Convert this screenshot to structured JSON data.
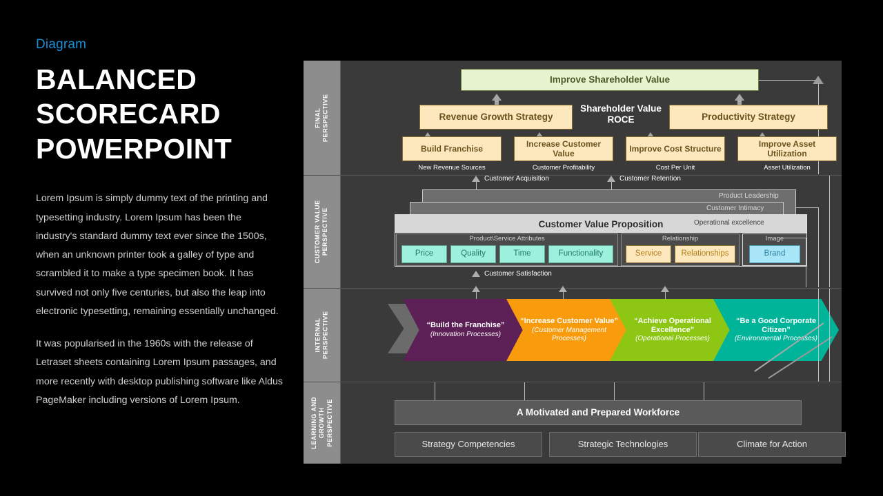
{
  "left": {
    "kicker": "Diagram",
    "title_lines": [
      "BALANCED",
      "SCORECARD",
      "POWERPOINT"
    ],
    "paragraphs": [
      "Lorem Ipsum is simply dummy text of the printing and typesetting industry. Lorem Ipsum has been the industry's standard dummy text ever since the 1500s, when an unknown printer took a galley of type and scrambled it to make a type specimen book. It has survived not only five centuries, but also the leap into electronic typesetting, remaining essentially unchanged.",
      "It was popularised in the 1960s with the release of Letraset sheets containing Lorem Ipsum passages, and more recently with desktop publishing software like Aldus PageMaker including versions of Lorem Ipsum."
    ]
  },
  "colors": {
    "accent_blue": "#1a8fd6",
    "panel_bg": "#3a3a3a",
    "side_label_bg": "#8d8d8d",
    "green_box": "#e8f3cf",
    "cream_box": "#fde8bd",
    "teal_box": "#9df0dc",
    "blue_box": "#a9e7f8",
    "chevron_purple": "#5c1f56",
    "chevron_orange": "#f89c0e",
    "chevron_green": "#8dc713",
    "chevron_teal": "#00b49a",
    "chevron_grey": "#6b6b6b"
  },
  "diagram": {
    "rows": [
      {
        "label": "FINAL\nPERSPECTIVE",
        "label_lines": [
          "FINAL",
          "PERSPECTIVE"
        ]
      },
      {
        "label": "CUSTOMER VALUE\nPERSPECTIVE",
        "label_lines": [
          "CUSTOMER VALUE",
          "PERSPECTIVE"
        ]
      },
      {
        "label": "INTERNAL\nPERSPECTIVE",
        "label_lines": [
          "INTERNAL",
          "PERSPECTIVE"
        ]
      },
      {
        "label": "LEARNING AND\nGROWTH\nPERSPECTIVE",
        "label_lines": [
          "LEARNING AND",
          "GROWTH",
          "PERSPECTIVE"
        ]
      }
    ],
    "final": {
      "top_box": "Improve Shareholder Value",
      "center_metric_line1": "Shareholder Value",
      "center_metric_line2": "ROCE",
      "strategy_left": "Revenue Growth Strategy",
      "strategy_right": "Productivity Strategy",
      "objectives": [
        {
          "title": "Build Franchise",
          "caption": "New Revenue Sources"
        },
        {
          "title": "Increase Customer Value",
          "caption": "Customer Profitability"
        },
        {
          "title": "Improve Cost Structure",
          "caption": "Cost Per Unit"
        },
        {
          "title": "Improve Asset Utilization",
          "caption": "Asset Utilization"
        }
      ]
    },
    "customer": {
      "arrow_labels": [
        "Customer Acquisition",
        "Customer Retention"
      ],
      "layers": [
        "Product Leadership",
        "Customer Intimacy"
      ],
      "proposition_title": "Customer Value Proposition",
      "proposition_tag": "Operational excellence",
      "groups": [
        {
          "name": "Product\\Service Attributes",
          "items": [
            "Price",
            "Quality",
            "Time",
            "Functionality"
          ]
        },
        {
          "name": "Relationship",
          "items": [
            "Service",
            "Relationships"
          ]
        },
        {
          "name": "Image",
          "items": [
            "Brand"
          ]
        }
      ],
      "bottom_label": "Customer Satisfaction"
    },
    "internal": {
      "chevrons": [
        {
          "title": "“Build the Franchise”",
          "subtitle": "(Innovation Processes)",
          "color": "#5c1f56"
        },
        {
          "title": "“Increase Customer Value”",
          "subtitle": "(Customer Management Processes)",
          "color": "#f89c0e"
        },
        {
          "title": "“Achieve Operational Excellence”",
          "subtitle": "(Operational Processes)",
          "color": "#8dc713"
        },
        {
          "title": "“Be a Good Corporate Citizen”",
          "subtitle": "(Environmental Processes)",
          "color": "#00b49a"
        }
      ]
    },
    "learning": {
      "banner": "A Motivated and Prepared Workforce",
      "items": [
        "Strategy Competencies",
        "Strategic Technologies",
        "Climate for Action"
      ]
    }
  }
}
